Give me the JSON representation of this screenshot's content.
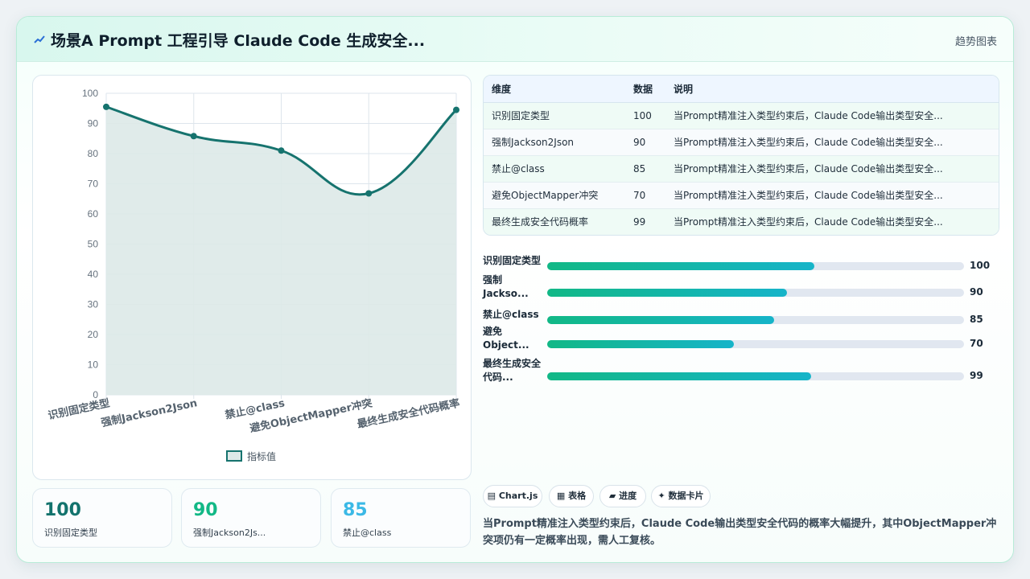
{
  "header": {
    "title": "场景A Prompt 工程引导 Claude Code 生成安全...",
    "right_link": "趋势图表"
  },
  "chart_data": {
    "type": "line",
    "categories": [
      "识别固定类型",
      "强制Jackson2Json",
      "禁止@class",
      "避免ObjectMapper冲突",
      "最终生成安全代码概率"
    ],
    "series": [
      {
        "name": "指标值",
        "values": [
          95.5,
          85.8,
          81,
          66.8,
          94.5
        ]
      }
    ],
    "ylim": [
      0,
      100
    ],
    "yticks": [
      0,
      10,
      20,
      30,
      40,
      50,
      60,
      70,
      80,
      90,
      100
    ],
    "grid": true,
    "legend": "bottom",
    "colors": {
      "line": "#16736e",
      "fill": "#dde9e8"
    }
  },
  "stats": [
    {
      "value": "100",
      "label": "识别固定类型",
      "color": "#13736d"
    },
    {
      "value": "90",
      "label": "强制Jackson2Js...",
      "color": "#12b886"
    },
    {
      "value": "85",
      "label": "禁止@class",
      "color": "#3bb9e6"
    }
  ],
  "table": {
    "headers": [
      "维度",
      "数据",
      "说明"
    ],
    "rows": [
      [
        "识别固定类型",
        "100",
        "当Prompt精准注入类型约束后，Claude Code输出类型安全..."
      ],
      [
        "强制Jackson2Json",
        "90",
        "当Prompt精准注入类型约束后，Claude Code输出类型安全..."
      ],
      [
        "禁止@class",
        "85",
        "当Prompt精准注入类型约束后，Claude Code输出类型安全..."
      ],
      [
        "避免ObjectMapper冲突",
        "70",
        "当Prompt精准注入类型约束后，Claude Code输出类型安全..."
      ],
      [
        "最终生成安全代码概率",
        "99",
        "当Prompt精准注入类型约束后，Claude Code输出类型安全..."
      ]
    ]
  },
  "progress": [
    {
      "label": "识别固定类型",
      "value": "100",
      "fraction": 0.64
    },
    {
      "label": "强制Jackso...",
      "value": "90",
      "fraction": 0.576
    },
    {
      "label": "禁止@class",
      "value": "85",
      "fraction": 0.544
    },
    {
      "label": "避免Object...",
      "value": "70",
      "fraction": 0.448
    },
    {
      "label": "最终生成安全代码...",
      "value": "99",
      "fraction": 0.634
    }
  ],
  "pills": [
    {
      "icon": "▤",
      "label": "Chart.js"
    },
    {
      "icon": "▦",
      "label": "表格"
    },
    {
      "icon": "▰",
      "label": "进度"
    },
    {
      "icon": "✦",
      "label": "数据卡片"
    }
  ],
  "summary": "当Prompt精准注入类型约束后，Claude Code输出类型安全代码的概率大幅提升，其中ObjectMapper冲突项仍有一定概率出现，需人工复核。"
}
